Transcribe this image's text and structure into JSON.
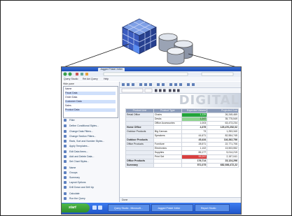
{
  "window": {
    "tab_title": "Jagged Pristel Xelter",
    "menu": [
      "Query Studio",
      "Rel Anl Query",
      "Help"
    ]
  },
  "left_pane": {
    "header": "Hide pane",
    "list_rows": [
      "Name",
      "Fiscal Data",
      "Order Data",
      "Customer Data",
      "Sales",
      "Product Data"
    ],
    "items": [
      "Filter",
      "Define Conditional Styles...",
      "Change Data Filters...",
      "Change Section Filters...",
      "Rank, Sort and Number Styles...",
      "Apply Templates...",
      "Edit Data Items...",
      "Add and Delete Data...",
      "Set Chart Styles...",
      "Name",
      "Groups",
      "Summary",
      "Layout Options",
      "Drill Down and Drill Up",
      "Calculate",
      "Run the Query"
    ]
  },
  "banner": {
    "text": "DIGITAL"
  },
  "table": {
    "headers": [
      "Product Line",
      "Product Type",
      "Expected Volume",
      "Projected Cost"
    ],
    "rows": [
      {
        "line": "Retail Office",
        "type": "Chairs",
        "vol": "1,129",
        "cost": "26,245,469",
        "style": "green"
      },
      {
        "line": "",
        "type": "Desks",
        "vol": "1,247",
        "cost": "35,775,549",
        "style": "lgreen"
      },
      {
        "line": "",
        "type": "Office Accessories",
        "vol": "1,003",
        "cost": "63,473,234",
        "style": ""
      },
      {
        "line": "Home Office",
        "type": "",
        "vol": "4,375",
        "cost": "125,470,252,02",
        "style": "bold"
      },
      {
        "line": "Outdoor Products",
        "type": "Big Canvas",
        "vol": "73",
        "cost": "1,253,340",
        "style": ""
      },
      {
        "line": "",
        "type": "Speakers",
        "vol": "44,671",
        "cost": "82,554,745",
        "style": ""
      },
      {
        "line": "Outdoor Products",
        "type": "",
        "vol": "45,434",
        "cost": "116,262,756",
        "style": "bold"
      },
      {
        "line": "Office Products",
        "type": "Furniture",
        "vol": "28,571",
        "cost": "22,771,706",
        "style": ""
      },
      {
        "line": "",
        "type": "Electronics",
        "vol": "1,102",
        "cost": "13,503,552",
        "style": ""
      },
      {
        "line": "",
        "type": "Supplies",
        "vol": "86,177",
        "cost": "5,014,219",
        "style": ""
      },
      {
        "line": "",
        "type": "Print Set",
        "vol": "99,297",
        "cost": "2,157,041",
        "style": "red"
      },
      {
        "line": "Office Products",
        "type": "",
        "vol": "176,714",
        "cost": "23,124,296",
        "style": "bold"
      },
      {
        "line": "Summary",
        "type": "",
        "vol": "571,075",
        "cost": "682,936,472,22",
        "style": "bold"
      }
    ]
  },
  "status": {
    "text": "Done"
  },
  "taskbar": {
    "start": "start",
    "tasks": [
      "Query Studio - Microsoft...",
      "Jagged Pristel Xelter",
      "Report Studio"
    ]
  }
}
